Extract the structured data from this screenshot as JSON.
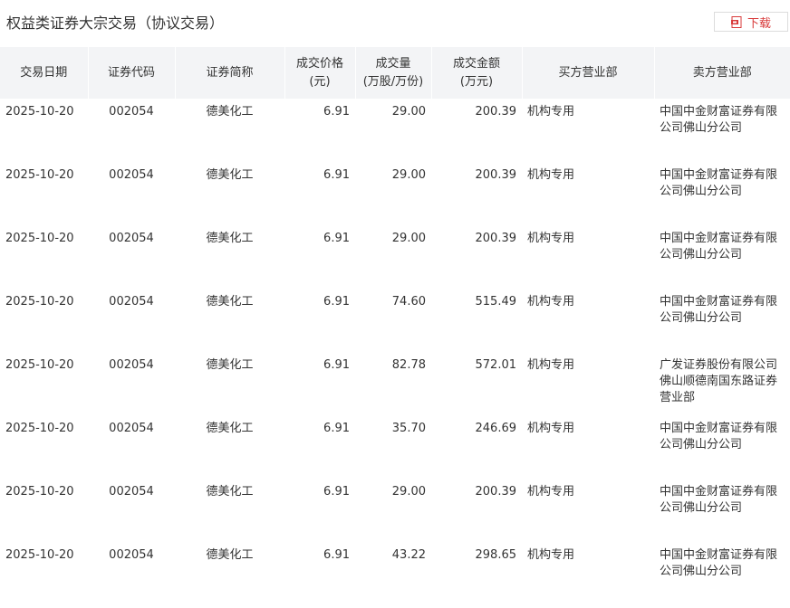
{
  "header": {
    "title": "权益类证券大宗交易（协议交易）",
    "download_label": "下载",
    "download_icon": "pdf-download-icon"
  },
  "table": {
    "columns": [
      "交易日期",
      "证券代码",
      "证券简称",
      "成交价格\n(元)",
      "成交量\n(万股/万份)",
      "成交金额\n(万元)",
      "买方营业部",
      "卖方营业部"
    ],
    "rows": [
      {
        "date": "2025-10-20",
        "code": "002054",
        "name": "德美化工",
        "price": "6.91",
        "volume": "29.00",
        "amount": "200.39",
        "buyer": "机构专用",
        "seller": "中国中金财富证券有限公司佛山分公司"
      },
      {
        "date": "2025-10-20",
        "code": "002054",
        "name": "德美化工",
        "price": "6.91",
        "volume": "29.00",
        "amount": "200.39",
        "buyer": "机构专用",
        "seller": "中国中金财富证券有限公司佛山分公司"
      },
      {
        "date": "2025-10-20",
        "code": "002054",
        "name": "德美化工",
        "price": "6.91",
        "volume": "29.00",
        "amount": "200.39",
        "buyer": "机构专用",
        "seller": "中国中金财富证券有限公司佛山分公司"
      },
      {
        "date": "2025-10-20",
        "code": "002054",
        "name": "德美化工",
        "price": "6.91",
        "volume": "74.60",
        "amount": "515.49",
        "buyer": "机构专用",
        "seller": "中国中金财富证券有限公司佛山分公司"
      },
      {
        "date": "2025-10-20",
        "code": "002054",
        "name": "德美化工",
        "price": "6.91",
        "volume": "82.78",
        "amount": "572.01",
        "buyer": "机构专用",
        "seller": "广发证券股份有限公司佛山顺德南国东路证券营业部"
      },
      {
        "date": "2025-10-20",
        "code": "002054",
        "name": "德美化工",
        "price": "6.91",
        "volume": "35.70",
        "amount": "246.69",
        "buyer": "机构专用",
        "seller": "中国中金财富证券有限公司佛山分公司"
      },
      {
        "date": "2025-10-20",
        "code": "002054",
        "name": "德美化工",
        "price": "6.91",
        "volume": "29.00",
        "amount": "200.39",
        "buyer": "机构专用",
        "seller": "中国中金财富证券有限公司佛山分公司"
      },
      {
        "date": "2025-10-20",
        "code": "002054",
        "name": "德美化工",
        "price": "6.91",
        "volume": "43.22",
        "amount": "298.65",
        "buyer": "机构专用",
        "seller": "中国中金财富证券有限公司佛山分公司"
      }
    ]
  },
  "colors": {
    "accent": "#d83a3a",
    "header_bg": "#f3f4f6",
    "text": "#333333"
  }
}
